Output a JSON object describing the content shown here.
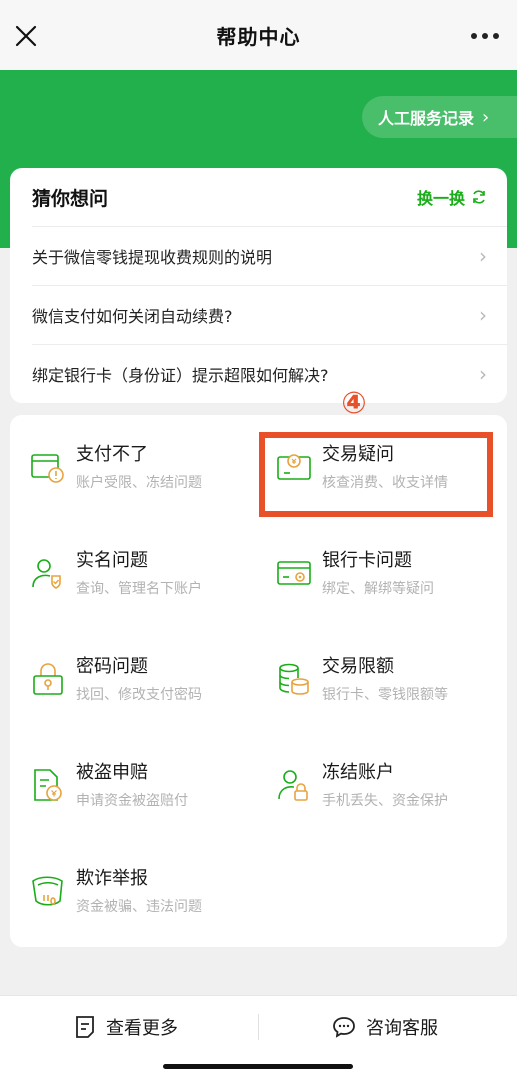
{
  "navbar": {
    "title": "帮助中心"
  },
  "banner": {
    "service_record": "人工服务记录"
  },
  "guess": {
    "title": "猜你想问",
    "refresh": "换一换",
    "items": [
      "关于微信零钱提现收费规则的说明",
      "微信支付如何关闭自动续费?",
      "绑定银行卡（身份证）提示超限如何解决?"
    ]
  },
  "annotation": {
    "marker": "④"
  },
  "categories": [
    {
      "title": "支付不了",
      "sub": "账户受限、冻结问题",
      "icon": "payment-failed-icon"
    },
    {
      "title": "交易疑问",
      "sub": "核查消费、收支详情",
      "icon": "transaction-query-icon"
    },
    {
      "title": "实名问题",
      "sub": "查询、管理名下账户",
      "icon": "real-name-icon"
    },
    {
      "title": "银行卡问题",
      "sub": "绑定、解绑等疑问",
      "icon": "bank-card-icon"
    },
    {
      "title": "密码问题",
      "sub": "找回、修改支付密码",
      "icon": "password-lock-icon"
    },
    {
      "title": "交易限额",
      "sub": "银行卡、零钱限额等",
      "icon": "coin-stack-icon"
    },
    {
      "title": "被盗申赔",
      "sub": "申请资金被盗赔付",
      "icon": "stolen-claim-icon"
    },
    {
      "title": "冻结账户",
      "sub": "手机丢失、资金保护",
      "icon": "freeze-account-icon"
    },
    {
      "title": "欺诈举报",
      "sub": "资金被骗、违法问题",
      "icon": "fraud-report-icon"
    }
  ],
  "bottom": {
    "more": "查看更多",
    "service": "咨询客服"
  },
  "colors": {
    "brand_green": "#21b04b",
    "accent_orange": "#e8502a",
    "icon_green": "#1aad19",
    "icon_orange": "#e7a33e"
  }
}
